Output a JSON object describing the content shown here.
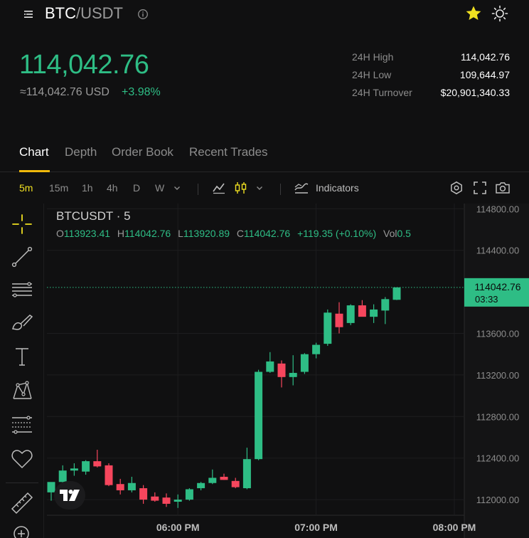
{
  "header": {
    "pair_base": "BTC",
    "pair_quote": "/USDT",
    "menu_icon": "menu-icon",
    "info_icon": "info-icon",
    "favorite_icon": "star-icon",
    "theme_icon": "sun-icon",
    "favorite_color": "#f0e021"
  },
  "price": {
    "last": "114,042.76",
    "usd": "≈114,042.76 USD",
    "change": "+3.98%",
    "up_color": "#2ebd85",
    "down_color": "#f6465d"
  },
  "stats": [
    {
      "label": "24H High",
      "value": "114,042.76"
    },
    {
      "label": "24H Low",
      "value": "109,644.97"
    },
    {
      "label": "24H Turnover",
      "value": "$20,901,340.33"
    }
  ],
  "tabs": [
    "Chart",
    "Depth",
    "Order Book",
    "Recent Trades"
  ],
  "active_tab": "Chart",
  "toolbar": {
    "timeframes": [
      "5m",
      "15m",
      "1h",
      "4h",
      "D",
      "W"
    ],
    "active_timeframe": "5m",
    "indicators_label": "Indicators",
    "accent_color": "#f0e021"
  },
  "tools": [
    "crosshair-icon",
    "trend-line-icon",
    "fib-lines-icon",
    "brush-icon",
    "text-icon",
    "pattern-icon",
    "measure-icon",
    "favorites-heart-icon",
    "ruler-icon",
    "zoom-in-icon"
  ],
  "legend": {
    "symbol": "BTCUSDT · 5",
    "o_label": "O",
    "o": "113923.41",
    "h_label": "H",
    "h": "114042.76",
    "l_label": "L",
    "l": "113920.89",
    "c_label": "C",
    "c": "114042.76",
    "change": "+119.35 (+0.10%)",
    "vol_label": "Vol",
    "vol": "0.5"
  },
  "chart_data": {
    "type": "candlestick",
    "interval": "5m",
    "ylim": [
      111850,
      114850
    ],
    "yticks": [
      "114800.00",
      "114400.00",
      "113600.00",
      "113200.00",
      "112800.00",
      "112400.00",
      "112000.00"
    ],
    "xtick_labels": [
      "06:00 PM",
      "07:00 PM",
      "08:00 PM"
    ],
    "price_tag": "114042.76",
    "countdown": "03:33",
    "candles": [
      {
        "o": 112070,
        "h": 112160,
        "l": 111990,
        "c": 112170
      },
      {
        "o": 112170,
        "h": 112330,
        "l": 112120,
        "c": 112280
      },
      {
        "o": 112280,
        "h": 112350,
        "l": 112230,
        "c": 112300
      },
      {
        "o": 112270,
        "h": 112380,
        "l": 112240,
        "c": 112370
      },
      {
        "o": 112370,
        "h": 112480,
        "l": 112310,
        "c": 112320
      },
      {
        "o": 112330,
        "h": 112350,
        "l": 112130,
        "c": 112140
      },
      {
        "o": 112150,
        "h": 112200,
        "l": 112050,
        "c": 112090
      },
      {
        "o": 112090,
        "h": 112220,
        "l": 112070,
        "c": 112160
      },
      {
        "o": 112110,
        "h": 112140,
        "l": 111960,
        "c": 112000
      },
      {
        "o": 112030,
        "h": 112070,
        "l": 111980,
        "c": 111990
      },
      {
        "o": 112020,
        "h": 112060,
        "l": 111930,
        "c": 111960
      },
      {
        "o": 111980,
        "h": 112050,
        "l": 111920,
        "c": 112000
      },
      {
        "o": 112000,
        "h": 112110,
        "l": 111990,
        "c": 112100
      },
      {
        "o": 112110,
        "h": 112170,
        "l": 112090,
        "c": 112160
      },
      {
        "o": 112160,
        "h": 112290,
        "l": 112150,
        "c": 112210
      },
      {
        "o": 112220,
        "h": 112250,
        "l": 112190,
        "c": 112190
      },
      {
        "o": 112180,
        "h": 112210,
        "l": 112110,
        "c": 112120
      },
      {
        "o": 112110,
        "h": 112500,
        "l": 112100,
        "c": 112390
      },
      {
        "o": 112390,
        "h": 113250,
        "l": 112380,
        "c": 113230
      },
      {
        "o": 113230,
        "h": 113420,
        "l": 113220,
        "c": 113330
      },
      {
        "o": 113310,
        "h": 113340,
        "l": 113080,
        "c": 113180
      },
      {
        "o": 113180,
        "h": 113390,
        "l": 113100,
        "c": 113220
      },
      {
        "o": 113230,
        "h": 113410,
        "l": 113210,
        "c": 113400
      },
      {
        "o": 113400,
        "h": 113510,
        "l": 113360,
        "c": 113490
      },
      {
        "o": 113500,
        "h": 113830,
        "l": 113480,
        "c": 113800
      },
      {
        "o": 113790,
        "h": 113900,
        "l": 113600,
        "c": 113660
      },
      {
        "o": 113700,
        "h": 113880,
        "l": 113680,
        "c": 113870
      },
      {
        "o": 113870,
        "h": 113920,
        "l": 113780,
        "c": 113760
      },
      {
        "o": 113760,
        "h": 113880,
        "l": 113700,
        "c": 113830
      },
      {
        "o": 113820,
        "h": 113950,
        "l": 113690,
        "c": 113930
      },
      {
        "o": 113923.41,
        "h": 114042.76,
        "l": 113920.89,
        "c": 114042.76
      }
    ]
  }
}
